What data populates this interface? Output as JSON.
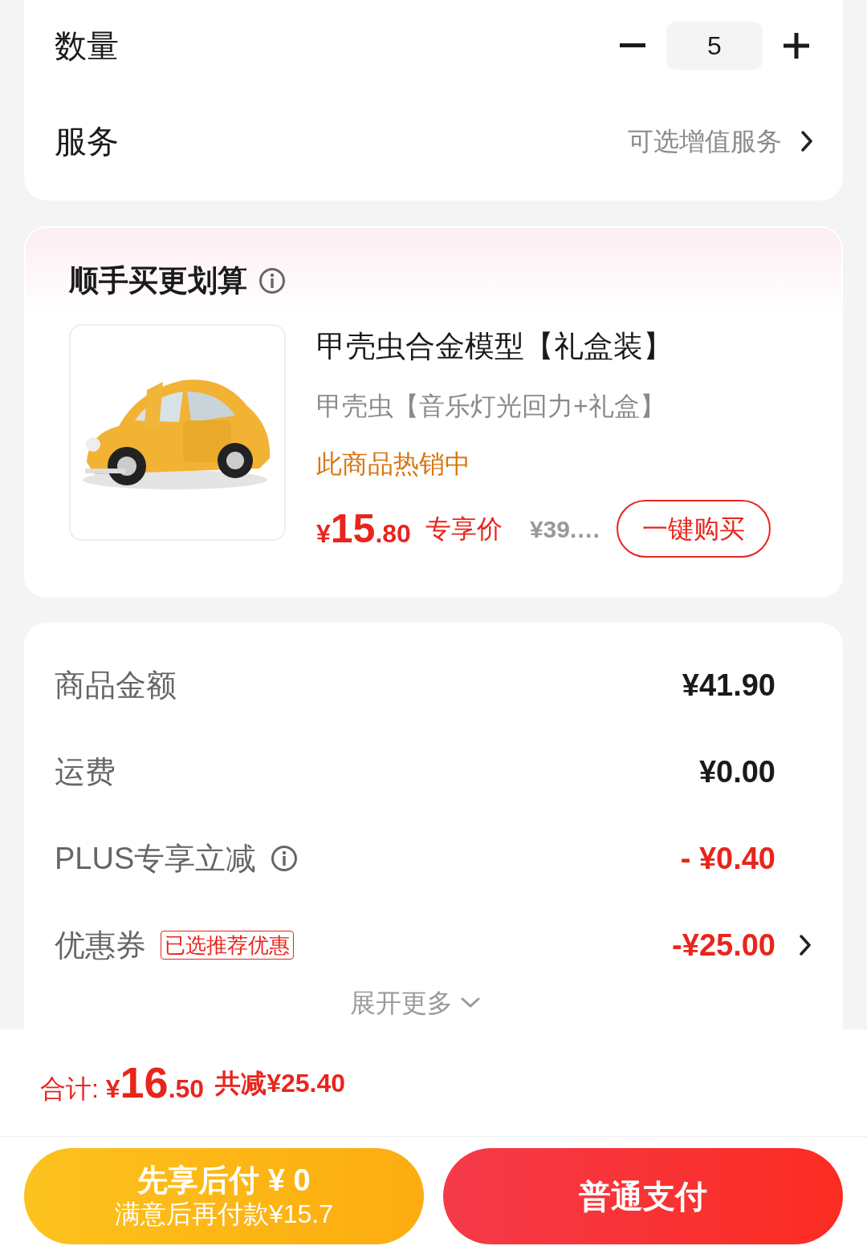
{
  "quantity": {
    "label": "数量",
    "value": "5"
  },
  "service": {
    "label": "服务",
    "value": "可选增值服务"
  },
  "addon": {
    "title": "顺手买更划算",
    "product": {
      "kind": "picture",
      "name": "甲壳虫合金模型【礼盒装】",
      "variant": "甲壳虫【音乐灯光回力+礼盒】",
      "status": "此商品热销中",
      "price_symbol": "¥",
      "price_int": "15",
      "price_dec": ".80",
      "price_label": "专享价",
      "original_price": "¥39.…",
      "button": "一键购买"
    }
  },
  "summary": {
    "rows": [
      {
        "label": "商品金额",
        "value": "¥41.90",
        "kind": "plain",
        "info": false,
        "link": false
      },
      {
        "label": "运费",
        "value": "¥0.00",
        "kind": "plain",
        "info": false,
        "link": false
      },
      {
        "label": "PLUS专享立减",
        "value": "- ¥0.40",
        "kind": "discount",
        "info": true,
        "link": false
      },
      {
        "label": "优惠券",
        "tag": "已选推荐优惠",
        "value": "-¥25.00",
        "kind": "discount",
        "info": false,
        "link": true
      }
    ],
    "expand": "展开更多"
  },
  "footer": {
    "total_label": "合计:",
    "symbol": "¥",
    "int": "16",
    "dec": ".50",
    "saved": "共减¥25.40",
    "buttons": [
      {
        "kind": "later",
        "title": "先享后付 ¥ 0",
        "subtitle": "满意后再付款¥15.7"
      },
      {
        "kind": "pay",
        "title": "普通支付"
      }
    ]
  }
}
